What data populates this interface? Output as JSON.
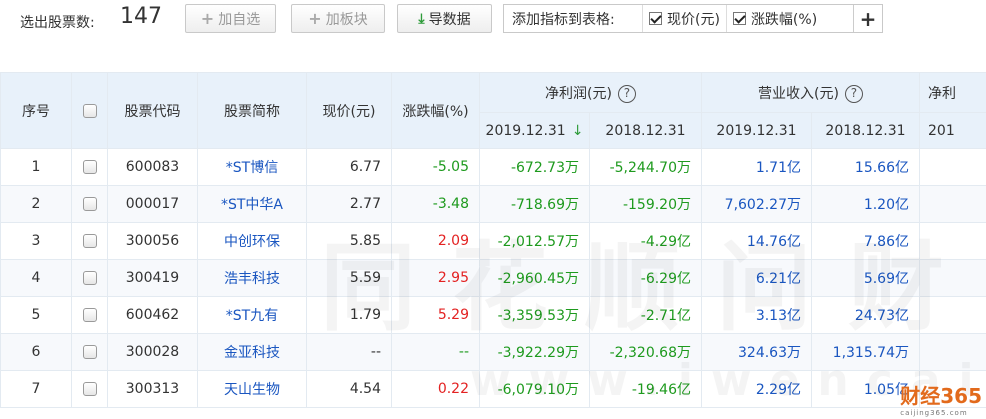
{
  "toolbar": {
    "count_label": "选出股票数:",
    "count_value": "147",
    "add_watch_label": "加自选",
    "add_block_label": "加板块",
    "export_label": "导数据",
    "indicator_title": "添加指标到表格:",
    "indicator_price_label": "现价(元)",
    "indicator_change_label": "涨跌幅(%)",
    "indicator_add_label": "+"
  },
  "table": {
    "headers": {
      "index": "序号",
      "code": "股票代码",
      "name": "股票简称",
      "price": "现价(元)",
      "change": "涨跌幅(%)",
      "net_profit": "净利润(元)",
      "revenue": "营业收入(元)",
      "more": "净利",
      "help": "?",
      "sort_arrow": "↓",
      "dates": [
        "2019.12.31",
        "2018.12.31",
        "2019.12.31",
        "2018.12.31",
        "201"
      ]
    },
    "rows": [
      {
        "index": "1",
        "code": "600083",
        "name": "*ST博信",
        "price": "6.77",
        "change": "-5.05",
        "np2019": "-672.73万",
        "np2018": "-5,244.70万",
        "rev2019": "1.71亿",
        "rev2018": "15.66亿",
        "change_color": "green",
        "np2019_color": "green",
        "np2018_color": "green",
        "rev2019_color": "blue",
        "rev2018_color": "blue"
      },
      {
        "index": "2",
        "code": "000017",
        "name": "*ST中华A",
        "price": "2.77",
        "change": "-3.48",
        "np2019": "-718.69万",
        "np2018": "-159.20万",
        "rev2019": "7,602.27万",
        "rev2018": "1.20亿",
        "change_color": "green",
        "np2019_color": "green",
        "np2018_color": "green",
        "rev2019_color": "blue",
        "rev2018_color": "blue"
      },
      {
        "index": "3",
        "code": "300056",
        "name": "中创环保",
        "price": "5.85",
        "change": "2.09",
        "np2019": "-2,012.57万",
        "np2018": "-4.29亿",
        "rev2019": "14.76亿",
        "rev2018": "7.86亿",
        "change_color": "red",
        "np2019_color": "green",
        "np2018_color": "green",
        "rev2019_color": "blue",
        "rev2018_color": "blue"
      },
      {
        "index": "4",
        "code": "300419",
        "name": "浩丰科技",
        "price": "5.59",
        "change": "2.95",
        "np2019": "-2,960.45万",
        "np2018": "-6.29亿",
        "rev2019": "6.21亿",
        "rev2018": "5.69亿",
        "change_color": "red",
        "np2019_color": "green",
        "np2018_color": "green",
        "rev2019_color": "blue",
        "rev2018_color": "blue"
      },
      {
        "index": "5",
        "code": "600462",
        "name": "*ST九有",
        "price": "1.79",
        "change": "5.29",
        "np2019": "-3,359.53万",
        "np2018": "-2.71亿",
        "rev2019": "3.13亿",
        "rev2018": "24.73亿",
        "change_color": "red",
        "np2019_color": "green",
        "np2018_color": "green",
        "rev2019_color": "blue",
        "rev2018_color": "blue"
      },
      {
        "index": "6",
        "code": "300028",
        "name": "金亚科技",
        "price": "--",
        "change": "--",
        "np2019": "-3,922.29万",
        "np2018": "-2,320.68万",
        "rev2019": "324.63万",
        "rev2018": "1,315.74万",
        "change_color": "green",
        "np2019_color": "green",
        "np2018_color": "green",
        "rev2019_color": "blue",
        "rev2018_color": "blue"
      },
      {
        "index": "7",
        "code": "300313",
        "name": "天山生物",
        "price": "4.54",
        "change": "0.22",
        "np2019": "-6,079.10万",
        "np2018": "-19.46亿",
        "rev2019": "2.29亿",
        "rev2018": "1.05亿",
        "change_color": "red",
        "np2019_color": "green",
        "np2018_color": "green",
        "rev2019_color": "blue",
        "rev2018_color": "blue"
      }
    ]
  },
  "watermark": {
    "text": "同花顺问财",
    "url_text": "www.iwencai.com"
  },
  "logo": {
    "text": "财经365",
    "sub": "caijing365.com"
  },
  "colors": {
    "header_bg": "#e8f1fa",
    "link_blue": "#1a56c0",
    "up_red": "#e32222",
    "down_green": "#1e9a1e"
  }
}
